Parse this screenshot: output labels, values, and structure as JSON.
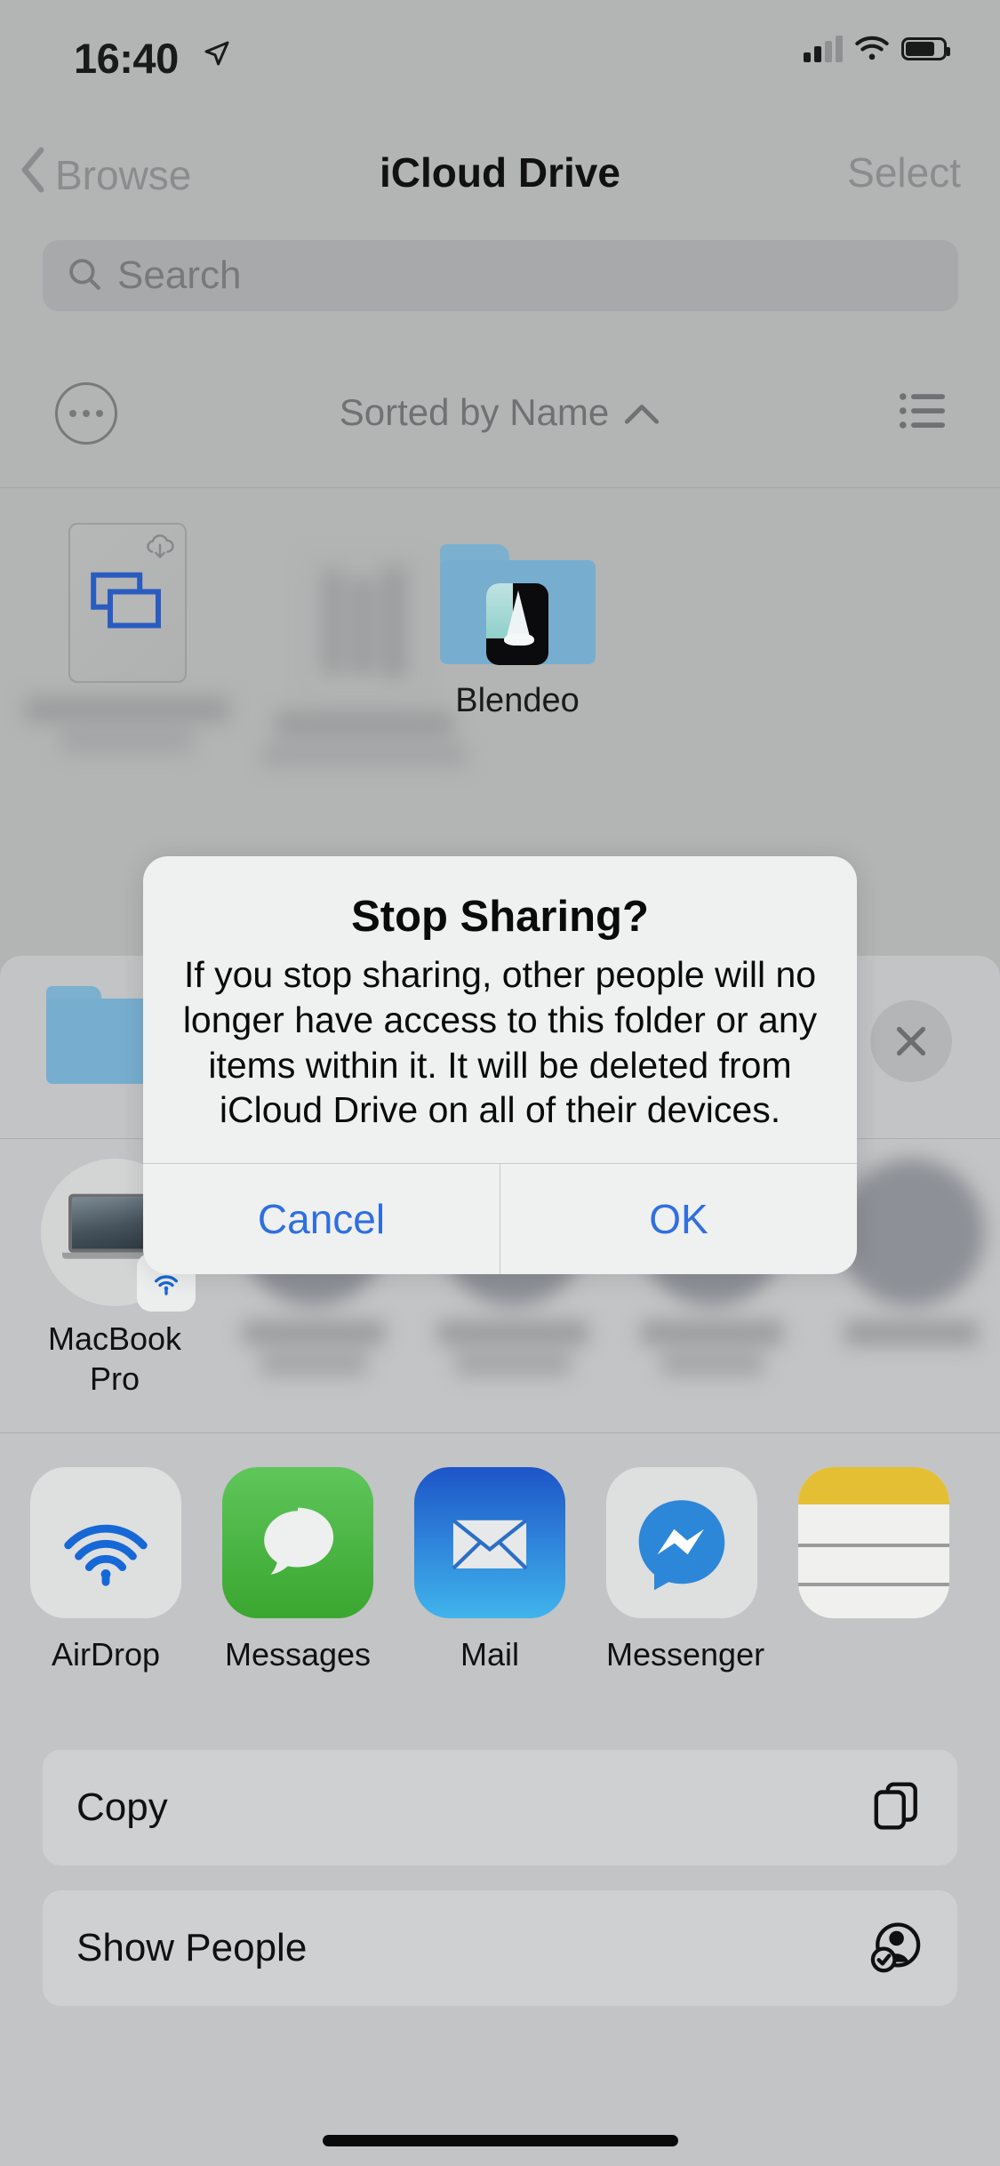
{
  "status_bar": {
    "time": "16:40",
    "location_icon": "location-arrow-icon",
    "cellular_icon": "cellular-bars-icon",
    "wifi_icon": "wifi-icon",
    "battery_icon": "battery-icon"
  },
  "nav_bar": {
    "back_label": "Browse",
    "title": "iCloud Drive",
    "select_label": "Select",
    "back_icon": "chevron-left-icon"
  },
  "search": {
    "placeholder": "Search",
    "value": "",
    "icon": "search-icon"
  },
  "sort_bar": {
    "more_icon": "ellipsis-circle-icon",
    "sort_label": "Sorted by Name",
    "sort_direction_icon": "chevron-up-icon",
    "view_toggle_icon": "list-view-icon"
  },
  "files": [
    {
      "name": "",
      "icon": "keynote-document-icon",
      "badge": "cloud-download-icon",
      "blurred_name": true
    },
    {
      "name": "",
      "icon": "document-icon",
      "badge": "",
      "blurred_name": true
    },
    {
      "name": "Blendeo",
      "icon": "folder-icon",
      "badge": "",
      "blurred_name": false
    }
  ],
  "share_sheet": {
    "item_icon": "folder-icon",
    "close_icon": "close-icon",
    "airdrop_contacts": [
      {
        "name": "MacBook Pro",
        "icon": "macbook-pro-icon",
        "badge": "airdrop-icon",
        "blurred": false
      },
      {
        "name": "",
        "icon": "contact-avatar-icon",
        "badge": "",
        "blurred": true
      },
      {
        "name": "",
        "icon": "contact-avatar-icon",
        "badge": "",
        "blurred": true
      },
      {
        "name": "",
        "icon": "contact-avatar-icon",
        "badge": "",
        "blurred": true
      },
      {
        "name": "",
        "icon": "contact-avatar-icon",
        "badge": "",
        "blurred": true
      }
    ],
    "apps": [
      {
        "label": "AirDrop",
        "icon": "airdrop-icon"
      },
      {
        "label": "Messages",
        "icon": "messages-icon"
      },
      {
        "label": "Mail",
        "icon": "mail-icon"
      },
      {
        "label": "Messenger",
        "icon": "messenger-icon"
      },
      {
        "label": "",
        "icon": "notes-icon"
      }
    ],
    "actions": [
      {
        "label": "Copy",
        "icon": "copy-icon"
      },
      {
        "label": "Show People",
        "icon": "show-people-icon"
      }
    ]
  },
  "alert": {
    "title": "Stop Sharing?",
    "message": "If you stop sharing, other people will no longer have access to this folder or any items within it. It will be deleted from iCloud Drive on all of their devices.",
    "cancel_label": "Cancel",
    "ok_label": "OK"
  },
  "colors": {
    "accent_blue": "#2f6fe0",
    "folder_blue": "#77aed0",
    "backdrop_gray": "#b3b4b4",
    "alert_bg": "#eff0f0"
  }
}
